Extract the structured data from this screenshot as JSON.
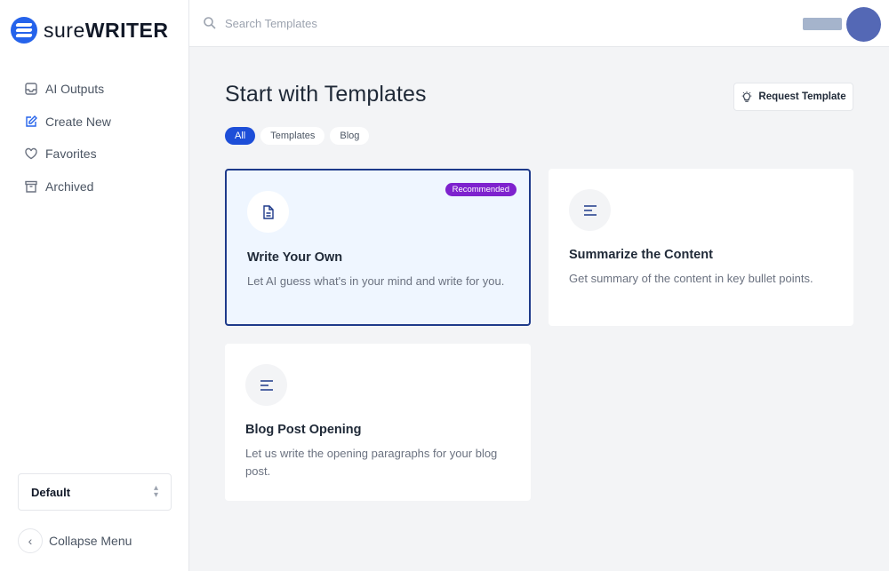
{
  "app": {
    "logo_prefix": "sure",
    "logo_suffix": "WRITER"
  },
  "sidebar": {
    "items": [
      {
        "label": "AI Outputs",
        "icon": "inbox-icon"
      },
      {
        "label": "Create New",
        "icon": "edit-icon"
      },
      {
        "label": "Favorites",
        "icon": "heart-icon"
      },
      {
        "label": "Archived",
        "icon": "archive-icon"
      }
    ],
    "workspace_label": "Default",
    "collapse_label": "Collapse Menu"
  },
  "search": {
    "placeholder": "Search Templates",
    "value": ""
  },
  "main": {
    "title": "Start with Templates",
    "request_label": "Request Template",
    "filters": [
      "All",
      "Templates",
      "Blog"
    ],
    "cards": [
      {
        "title": "Write Your Own",
        "description": "Let AI guess what's in your mind and write for you.",
        "badge": "Recommended",
        "icon": "document-icon"
      },
      {
        "title": "Summarize the Content",
        "description": "Get summary of the content in key bullet points.",
        "icon": "text-lines-icon"
      },
      {
        "title": "Blog Post Opening",
        "description": "Let us write the opening paragraphs for your blog post.",
        "icon": "text-lines-icon"
      }
    ]
  },
  "colors": {
    "accent": "#1d4ed8",
    "badge": "#7e22ce",
    "selected_border": "#1e3a8a"
  }
}
